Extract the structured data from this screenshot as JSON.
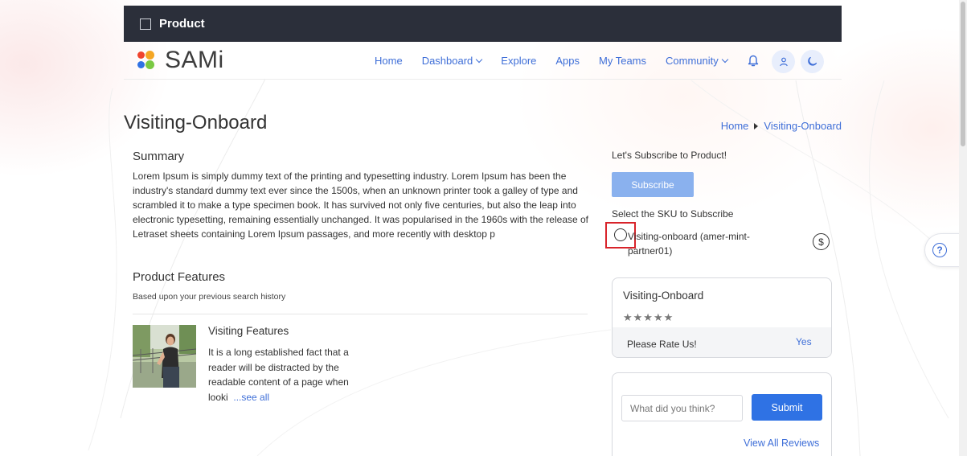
{
  "topbar": {
    "title": "Product"
  },
  "brand": {
    "name": "SAMi"
  },
  "nav": {
    "items": [
      {
        "label": "Home"
      },
      {
        "label": "Dashboard"
      },
      {
        "label": "Explore"
      },
      {
        "label": "Apps"
      },
      {
        "label": "My Teams"
      },
      {
        "label": "Community"
      }
    ]
  },
  "page": {
    "title": "Visiting-Onboard",
    "breadcrumb": [
      "Home",
      "Visiting-Onboard"
    ]
  },
  "summary": {
    "heading": "Summary",
    "text": "Lorem Ipsum is simply dummy text of the printing and typesetting industry. Lorem Ipsum has been the industry's standard dummy text ever since the 1500s, when an unknown printer took a galley of type and scrambled it to make a type specimen book. It has survived not only five centuries, but also the leap into electronic typesetting, remaining essentially unchanged. It was popularised in the 1960s with the release of Letraset sheets containing Lorem Ipsum passages, and more recently with desktop p"
  },
  "features": {
    "heading": "Product Features",
    "subheading": "Based upon your previous search history",
    "item": {
      "title": "Visiting Features",
      "text": "It is a long established fact that a reader will be distracted by the readable content of a page when looki",
      "link": "...see all"
    }
  },
  "subscribe": {
    "prompt": "Let's Subscribe to Product!",
    "button": "Subscribe",
    "sku_label": "Select the SKU to Subscribe",
    "sku_option": "Visiting-onboard (amer-mint-partner01)",
    "price_symbol": "$"
  },
  "rating": {
    "title": "Visiting-Onboard",
    "stars": "★★★★★",
    "prompt": "Please Rate Us!",
    "action": "Yes"
  },
  "review": {
    "placeholder": "What did you think?",
    "submit": "Submit",
    "view_all": "View All Reviews"
  },
  "help": {
    "symbol": "?"
  },
  "colors": {
    "accent": "#3f6fd8",
    "topbar": "#2b2f3a",
    "subscribe_button": "#8ab1ee",
    "submit_button": "#2f72e4",
    "highlight": "#d8232a"
  }
}
